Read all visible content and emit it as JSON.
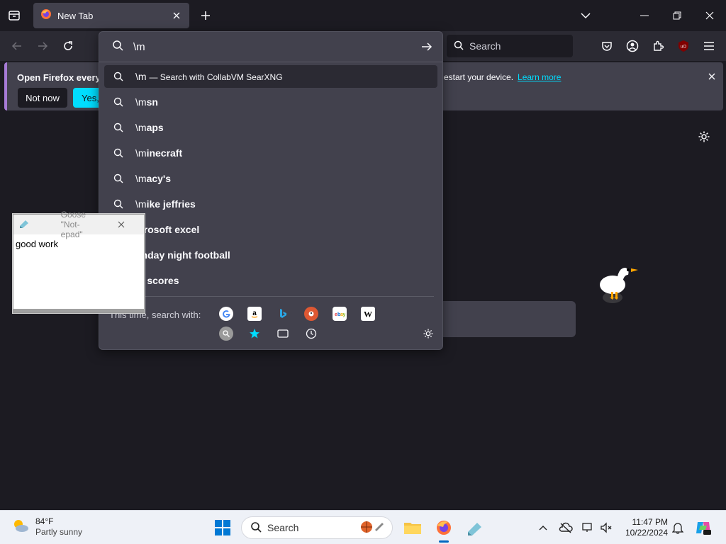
{
  "browser": {
    "tab": {
      "title": "New Tab"
    },
    "search_placeholder": "Search"
  },
  "notification": {
    "text_left": "Open Firefox every ti",
    "text_right": "estart your device.",
    "link": "Learn more",
    "not_now": "Not now",
    "yes": "Yes, c"
  },
  "urlbar": {
    "value": "\\m",
    "results": [
      {
        "prefix": "\\m",
        "suffix": "",
        "action": "— Search with CollabVM SearXNG"
      },
      {
        "prefix": "\\m",
        "suffix": "sn",
        "action": ""
      },
      {
        "prefix": "\\m",
        "suffix": "aps",
        "action": ""
      },
      {
        "prefix": "\\m",
        "suffix": "inecraft",
        "action": ""
      },
      {
        "prefix": "\\m",
        "suffix": "acy's",
        "action": ""
      },
      {
        "prefix": "\\m",
        "suffix": "ike jeffries",
        "action": ""
      },
      {
        "prefix": "",
        "suffix": "icrosoft excel",
        "action": ""
      },
      {
        "prefix": "",
        "suffix": "onday night football",
        "action": ""
      },
      {
        "prefix": "",
        "suffix": "lb scores",
        "action": ""
      }
    ],
    "oneoff_label": "This time, search with:",
    "engines": [
      "google",
      "amazon",
      "bing",
      "duckduckgo",
      "ebay",
      "wikipedia",
      "searxng",
      "bookmarks",
      "tabs",
      "history"
    ]
  },
  "content": {
    "glyph": "x"
  },
  "notepad": {
    "title": "Goose \"Not-epad\"",
    "body": "good work"
  },
  "taskbar": {
    "weather_temp": "84°F",
    "weather_cond": "Partly sunny",
    "search_label": "Search",
    "time": "11:47 PM",
    "date": "10/22/2024"
  },
  "colors": {
    "accent": "#00ddff",
    "toolbar": "#2b2a33",
    "popup": "#42414d"
  }
}
